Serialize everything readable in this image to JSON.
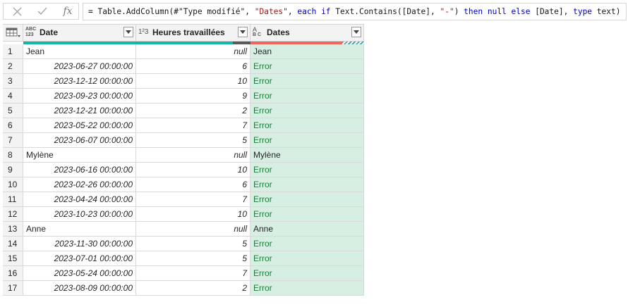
{
  "formula_bar": {
    "cancel_icon": "close-icon",
    "confirm_icon": "check-icon",
    "fx_label": "fx",
    "formula_parts": [
      {
        "text": "= Table.AddColumn(#\"Type modifié\", ",
        "kind": "plain"
      },
      {
        "text": "\"Dates\"",
        "kind": "str"
      },
      {
        "text": ", ",
        "kind": "plain"
      },
      {
        "text": "each if",
        "kind": "kw"
      },
      {
        "text": " Text.Contains([Date], ",
        "kind": "plain"
      },
      {
        "text": "\"-\"",
        "kind": "str"
      },
      {
        "text": ") ",
        "kind": "plain"
      },
      {
        "text": "then null else",
        "kind": "kw"
      },
      {
        "text": " [Date], ",
        "kind": "plain"
      },
      {
        "text": "type",
        "kind": "kw"
      },
      {
        "text": " text)",
        "kind": "plain"
      }
    ]
  },
  "colors": {
    "quality_valid": "#11b7a8",
    "quality_empty": "#5a5a5a",
    "quality_error": "#f0665c",
    "selected_column_bg": "#d6efe2",
    "error_text": "#1e7a3e"
  },
  "columns": [
    {
      "type_label_top": "ABC",
      "type_label_bottom": "123",
      "type_icon": "any-type-icon",
      "name": "Date"
    },
    {
      "type_label_top": "1²3",
      "type_label_bottom": "",
      "type_icon": "number-type-icon",
      "name": "Heures travaillées"
    },
    {
      "type_label_top": "A",
      "type_label_bottom": "B C",
      "type_icon": "text-type-icon",
      "name": "Dates"
    }
  ],
  "rows": [
    {
      "idx": "1",
      "date": "Jean",
      "heures": "null",
      "dates": "Jean"
    },
    {
      "idx": "2",
      "date": "2023-06-27 00:00:00",
      "heures": "6",
      "dates": "Error"
    },
    {
      "idx": "3",
      "date": "2023-12-12 00:00:00",
      "heures": "10",
      "dates": "Error"
    },
    {
      "idx": "4",
      "date": "2023-09-23 00:00:00",
      "heures": "9",
      "dates": "Error"
    },
    {
      "idx": "5",
      "date": "2023-12-21 00:00:00",
      "heures": "2",
      "dates": "Error"
    },
    {
      "idx": "6",
      "date": "2023-05-22 00:00:00",
      "heures": "7",
      "dates": "Error"
    },
    {
      "idx": "7",
      "date": "2023-06-07 00:00:00",
      "heures": "5",
      "dates": "Error"
    },
    {
      "idx": "8",
      "date": "Mylène",
      "heures": "null",
      "dates": "Mylène"
    },
    {
      "idx": "9",
      "date": "2023-06-16 00:00:00",
      "heures": "10",
      "dates": "Error"
    },
    {
      "idx": "10",
      "date": "2023-02-26 00:00:00",
      "heures": "6",
      "dates": "Error"
    },
    {
      "idx": "11",
      "date": "2023-04-24 00:00:00",
      "heures": "7",
      "dates": "Error"
    },
    {
      "idx": "12",
      "date": "2023-10-23 00:00:00",
      "heures": "10",
      "dates": "Error"
    },
    {
      "idx": "13",
      "date": "Anne",
      "heures": "null",
      "dates": "Anne"
    },
    {
      "idx": "14",
      "date": "2023-11-30 00:00:00",
      "heures": "5",
      "dates": "Error"
    },
    {
      "idx": "15",
      "date": "2023-07-01 00:00:00",
      "heures": "5",
      "dates": "Error"
    },
    {
      "idx": "16",
      "date": "2023-05-24 00:00:00",
      "heures": "7",
      "dates": "Error"
    },
    {
      "idx": "17",
      "date": "2023-08-09 00:00:00",
      "heures": "2",
      "dates": "Error"
    }
  ]
}
